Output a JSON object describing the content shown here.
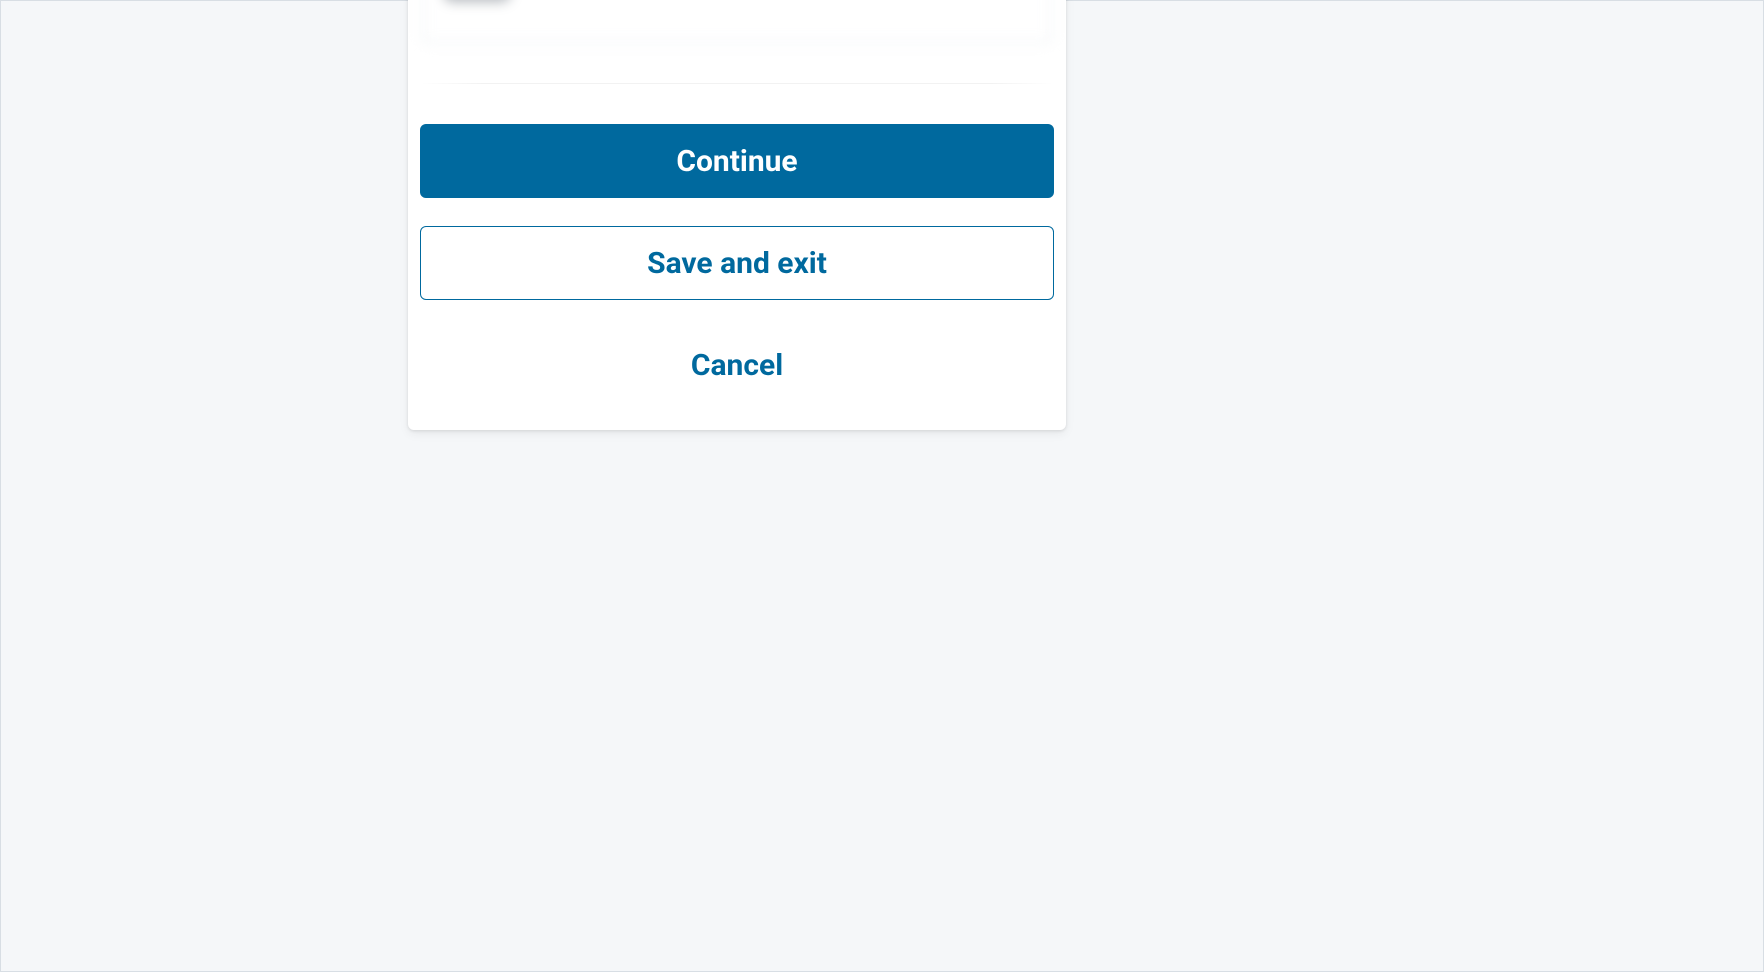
{
  "dialog": {
    "actions": {
      "continue_label": "Continue",
      "save_exit_label": "Save and exit",
      "cancel_label": "Cancel"
    }
  }
}
